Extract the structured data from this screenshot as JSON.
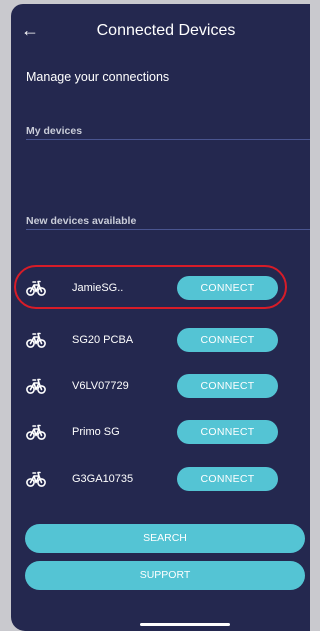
{
  "header": {
    "back_icon": "arrow-left-icon",
    "title": "Connected Devices"
  },
  "subtitle": "Manage your connections",
  "sections": {
    "my_devices": "My devices",
    "new_devices": "New devices available"
  },
  "devices": [
    {
      "name": "JamieSG..",
      "action": "CONNECT",
      "icon": "bike-icon",
      "highlighted": true
    },
    {
      "name": "SG20 PCBA",
      "action": "CONNECT",
      "icon": "bike-icon"
    },
    {
      "name": "V6LV07729",
      "action": "CONNECT",
      "icon": "bike-icon"
    },
    {
      "name": "Primo SG",
      "action": "CONNECT",
      "icon": "bike-icon"
    },
    {
      "name": "G3GA10735",
      "action": "CONNECT",
      "icon": "bike-icon"
    }
  ],
  "buttons": {
    "search": "SEARCH",
    "support": "SUPPORT"
  },
  "colors": {
    "background": "#24284f",
    "accent": "#54c4d4",
    "highlight_ring": "#d71c28"
  }
}
